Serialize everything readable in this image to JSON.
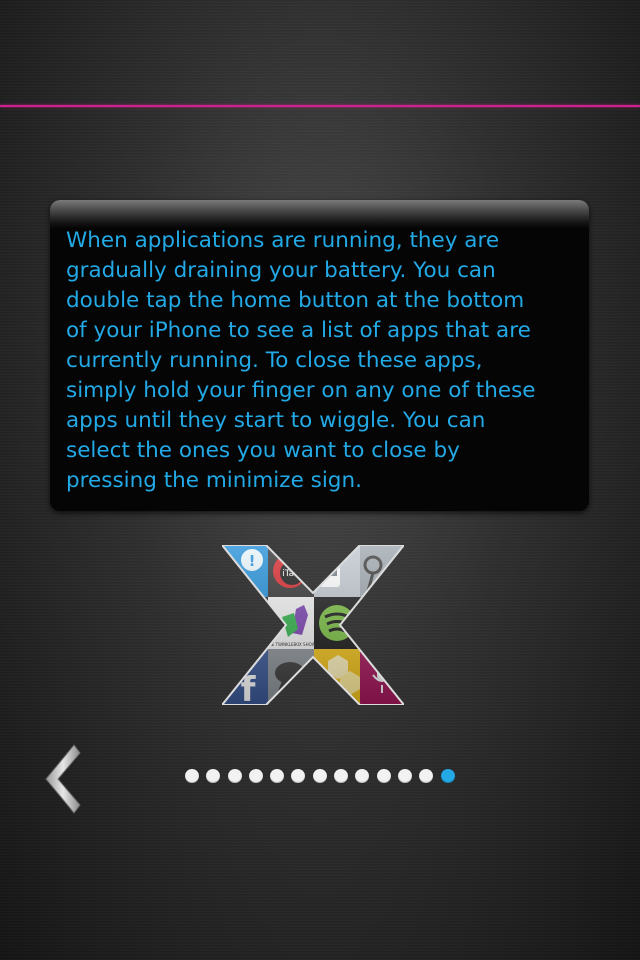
{
  "tutorial": {
    "body_text": "When applications are running, they are\ngradually draining your battery.  You can\ndouble tap the home button at the bottom\nof your iPhone to  see a list of apps that are\ncurrently running.  To close these apps,\nsimply hold your finger on any one of these\napps until they start to wiggle.  You can\nselect the ones you want to close by\npressing the minimize sign.",
    "text_color": "#22a9e6"
  },
  "accent_line_color": "#d0208f",
  "logo": {
    "icon": "x-app-collage-icon",
    "tile_labels": [
      "iTalk",
      "THE TWINKLEBOX SHOW"
    ]
  },
  "navigation": {
    "back_icon": "chevron-left-icon"
  },
  "pager": {
    "total_pages": 13,
    "current_page": 13,
    "active_color": "#22a9e6",
    "inactive_color": "#f2f2f2"
  }
}
